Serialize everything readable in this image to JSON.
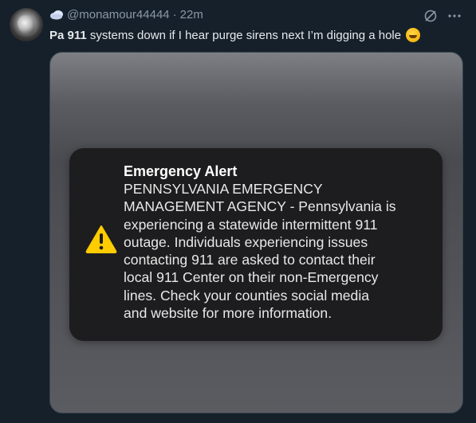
{
  "tweet": {
    "handle": "@monamour44444",
    "separator": "·",
    "time": "22m",
    "text_bold": "Pa 911",
    "text_rest": " systems down if I hear purge sirens next I’m digging a hole "
  },
  "alert": {
    "title": "Emergency Alert",
    "body": "PENNSYLVANIA EMERGENCY\nMANAGEMENT AGENCY - Pennsylvania is\nexperiencing a statewide intermittent 911\noutage.  Individuals experiencing issues\ncontacting 911 are asked to contact their\nlocal 911 Center on their non-Emergency\nlines.  Check your counties social media\nand website for more information."
  },
  "icons": {
    "header_badge": "cloud-icon",
    "grok": "grok-icon",
    "more": "more-icon",
    "emoji": "rofl-emoji-icon",
    "warning": "warning-icon"
  },
  "colors": {
    "background": "#15202b",
    "text": "#e7e9ea",
    "muted": "#8b98a5",
    "warning_yellow": "#ffcc00"
  }
}
